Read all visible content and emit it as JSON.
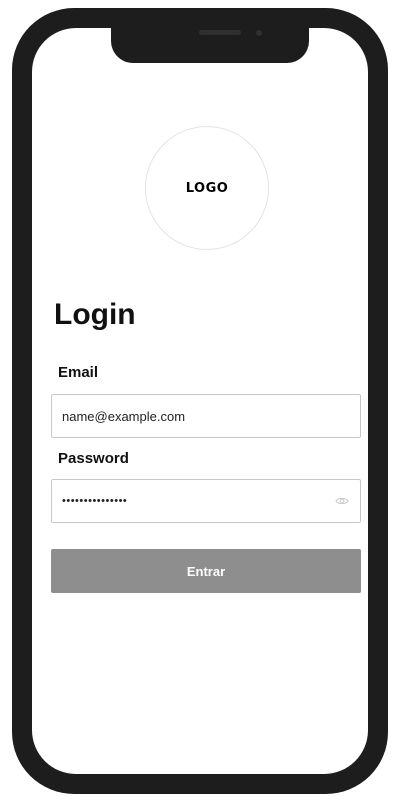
{
  "logo": {
    "text": "LOGO"
  },
  "login": {
    "title": "Login",
    "email": {
      "label": "Email",
      "value": "name@example.com"
    },
    "password": {
      "label": "Password",
      "value": "•••••••••••••••",
      "toggle_icon": "eye-icon"
    },
    "submit_label": "Entrar"
  },
  "colors": {
    "device_frame": "#1d1d1d",
    "button_background": "#8e8e8e",
    "field_border": "#c8c8c8"
  }
}
